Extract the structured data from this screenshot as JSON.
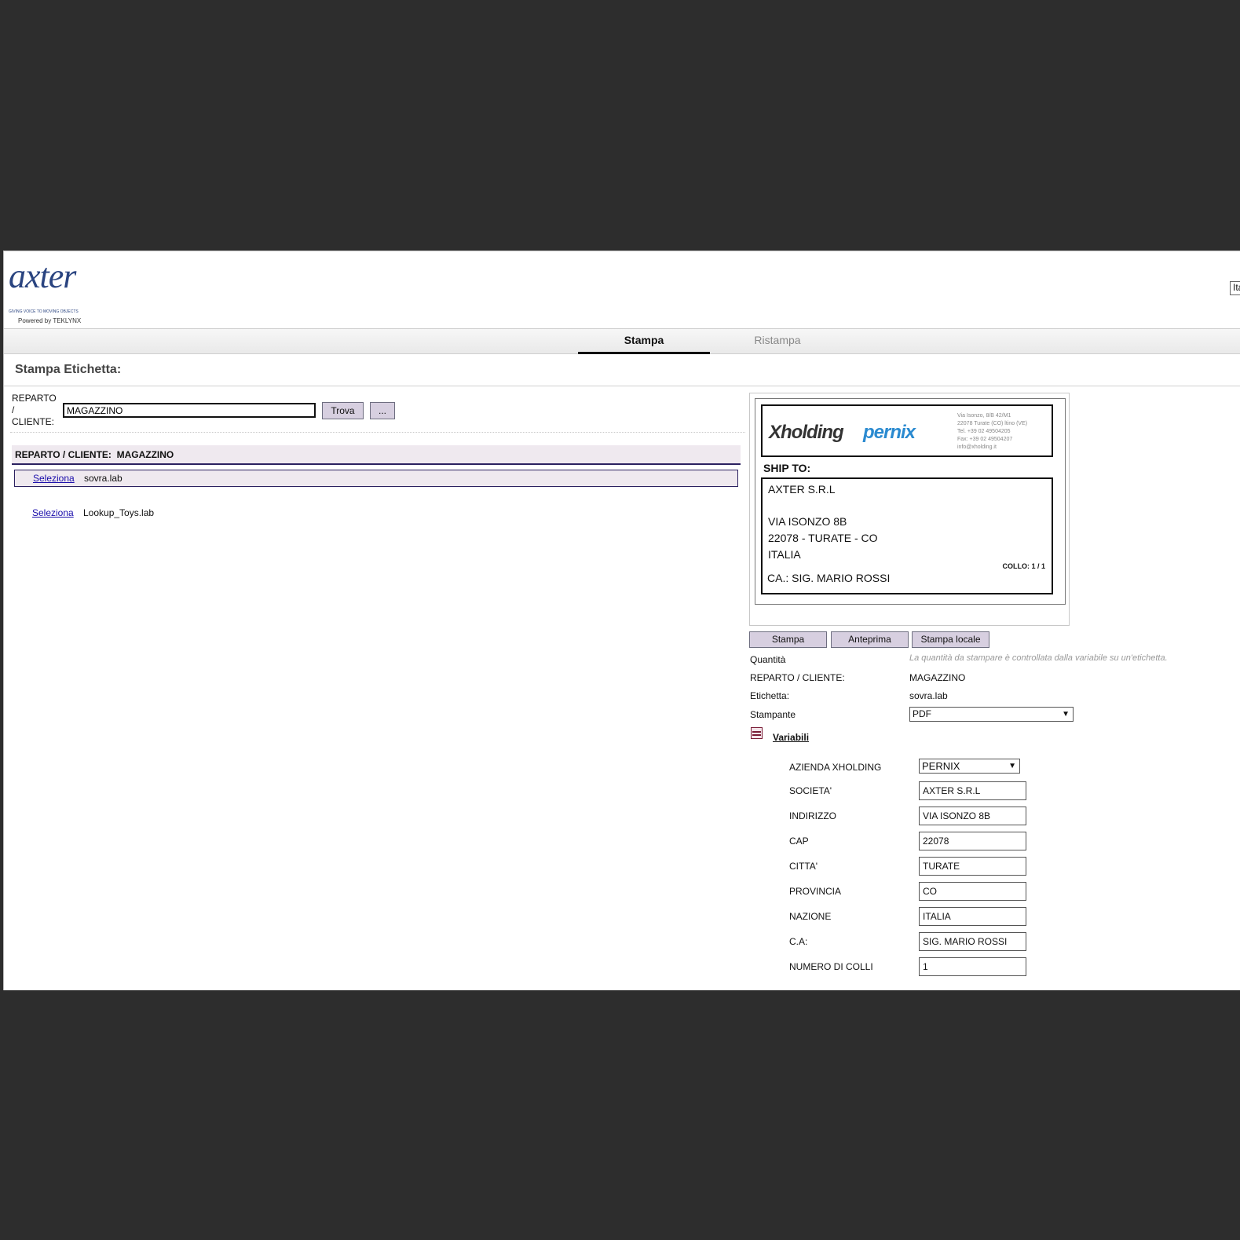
{
  "header": {
    "logo_text": "axter",
    "logo_tagline": "GIVING VOICE TO MOVING OBJECTS",
    "logo_powered": "Powered by TEKLYNX",
    "language_stub": "Ita"
  },
  "tabs": [
    {
      "label": "Stampa",
      "active": true
    },
    {
      "label": "Ristampa",
      "active": false
    }
  ],
  "page_title": "Stampa Etichetta:",
  "search": {
    "label_line1": "REPARTO",
    "label_line2": "/",
    "label_line3": "CLIENTE:",
    "value": "MAGAZZINO",
    "find_button": "Trova",
    "more_button": "..."
  },
  "list": {
    "header_label": "REPARTO / CLIENTE:",
    "header_value": "MAGAZZINO",
    "rows": [
      {
        "action": "Seleziona",
        "file": "sovra.lab",
        "selected": true
      },
      {
        "action": "Seleziona",
        "file": "Lookup_Toys.lab",
        "selected": false
      }
    ]
  },
  "preview": {
    "brand1": "Xholding",
    "brand2": "pernix",
    "address_lines": [
      "Via Isonzo, 8/B 42/M1",
      "22078 Turate (CO) ltino (VE)",
      "Tel. +39 02 49504205",
      "Fax: +39 02 49504207",
      "info@xholding.it"
    ],
    "ship_to": "SHIP TO:",
    "company": "AXTER S.R.L",
    "street": "VIA ISONZO 8B",
    "city_line": "22078 - TURATE - CO",
    "country": "ITALIA",
    "attention": "CA.: SIG. MARIO ROSSI",
    "collo": "COLLO: 1 / 1"
  },
  "actions": {
    "print": "Stampa",
    "preview": "Anteprima",
    "local_print": "Stampa locale"
  },
  "form": {
    "quantity_label": "Quantità",
    "quantity_note": "La quantità da stampare è controllata dalla variabile su un'etichetta.",
    "dept_label": "REPARTO / CLIENTE:",
    "dept_value": "MAGAZZINO",
    "label_label": "Etichetta:",
    "label_value": "sovra.lab",
    "printer_label": "Stampante",
    "printer_value": "PDF"
  },
  "variables": {
    "toggle_label": "Variabili",
    "azienda_label": "AZIENDA XHOLDING",
    "azienda_value": "PERNIX",
    "fields": [
      {
        "label": "SOCIETA'",
        "value": "AXTER S.R.L"
      },
      {
        "label": "INDIRIZZO",
        "value": "VIA ISONZO 8B"
      },
      {
        "label": "CAP",
        "value": "22078"
      },
      {
        "label": "CITTA'",
        "value": "TURATE"
      },
      {
        "label": "PROVINCIA",
        "value": "CO"
      },
      {
        "label": "NAZIONE",
        "value": "ITALIA"
      },
      {
        "label": "C.A:",
        "value": "SIG. MARIO ROSSI"
      },
      {
        "label": "NUMERO DI COLLI",
        "value": "1"
      }
    ]
  },
  "colors": {
    "button_bg": "#d7cfe0",
    "selection_border": "#2b2160",
    "link": "#1a0dab",
    "brand_blue": "#2a8ad0"
  }
}
